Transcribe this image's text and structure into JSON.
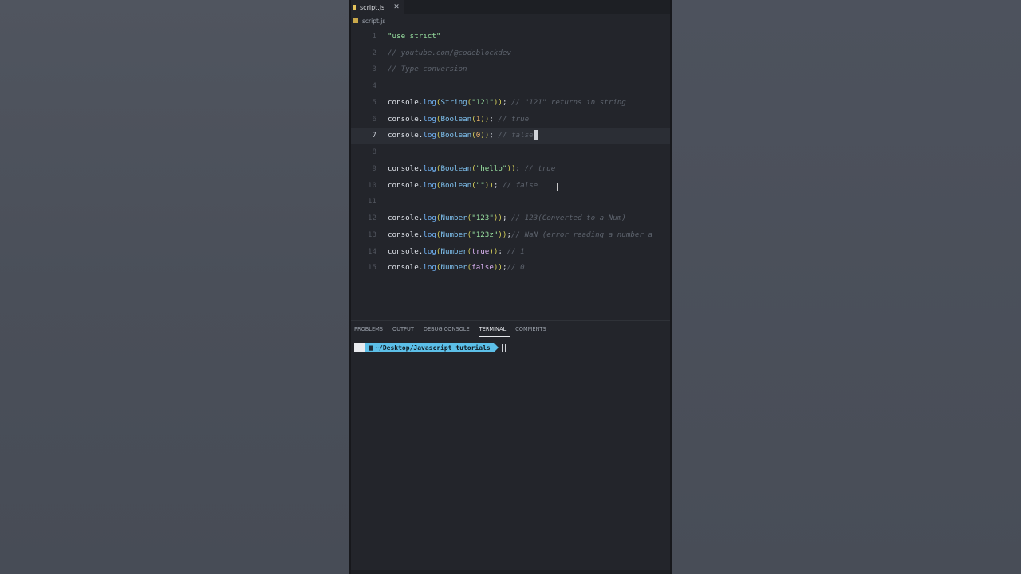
{
  "tab": {
    "filename": "script.js",
    "close": "✕"
  },
  "breadcrumb": {
    "filename": "script.js"
  },
  "code": [
    {
      "n": "1",
      "tokens": [
        [
          "str",
          "\"use strict\""
        ]
      ]
    },
    {
      "n": "2",
      "tokens": [
        [
          "cm",
          "// youtube.com/@codeblockdev"
        ]
      ]
    },
    {
      "n": "3",
      "tokens": [
        [
          "cm",
          "// Type conversion"
        ]
      ]
    },
    {
      "n": "4",
      "tokens": []
    },
    {
      "n": "5",
      "tokens": [
        [
          "src",
          "console"
        ],
        [
          "src",
          "."
        ],
        [
          "fn",
          "log"
        ],
        [
          "par",
          "("
        ],
        [
          "typ",
          "String"
        ],
        [
          "par",
          "("
        ],
        [
          "str",
          "\"121\""
        ],
        [
          "par",
          "))"
        ],
        [
          "src",
          "; "
        ],
        [
          "cm",
          "// \"121\" returns in string"
        ]
      ]
    },
    {
      "n": "6",
      "tokens": [
        [
          "src",
          "console"
        ],
        [
          "src",
          "."
        ],
        [
          "fn",
          "log"
        ],
        [
          "par",
          "("
        ],
        [
          "typ",
          "Boolean"
        ],
        [
          "par",
          "("
        ],
        [
          "num",
          "1"
        ],
        [
          "par",
          "))"
        ],
        [
          "src",
          "; "
        ],
        [
          "cm",
          "// true"
        ]
      ]
    },
    {
      "n": "7",
      "active": true,
      "tokens": [
        [
          "src",
          "console"
        ],
        [
          "src",
          "."
        ],
        [
          "fn",
          "log"
        ],
        [
          "par",
          "("
        ],
        [
          "typ",
          "Boolean"
        ],
        [
          "par",
          "("
        ],
        [
          "num",
          "0"
        ],
        [
          "par",
          "))"
        ],
        [
          "src",
          "; "
        ],
        [
          "cm",
          "// false"
        ],
        [
          "cursor",
          ""
        ]
      ]
    },
    {
      "n": "8",
      "tokens": []
    },
    {
      "n": "9",
      "tokens": [
        [
          "src",
          "console"
        ],
        [
          "src",
          "."
        ],
        [
          "fn",
          "log"
        ],
        [
          "par",
          "("
        ],
        [
          "typ",
          "Boolean"
        ],
        [
          "par",
          "("
        ],
        [
          "str",
          "\"hello\""
        ],
        [
          "par",
          "))"
        ],
        [
          "src",
          "; "
        ],
        [
          "cm",
          "// true"
        ]
      ]
    },
    {
      "n": "10",
      "tokens": [
        [
          "src",
          "console"
        ],
        [
          "src",
          "."
        ],
        [
          "fn",
          "log"
        ],
        [
          "par",
          "("
        ],
        [
          "typ",
          "Boolean"
        ],
        [
          "par",
          "("
        ],
        [
          "str",
          "\"\""
        ],
        [
          "par",
          "))"
        ],
        [
          "src",
          "; "
        ],
        [
          "cm",
          "// false"
        ]
      ]
    },
    {
      "n": "11",
      "tokens": []
    },
    {
      "n": "12",
      "tokens": [
        [
          "src",
          "console"
        ],
        [
          "src",
          "."
        ],
        [
          "fn",
          "log"
        ],
        [
          "par",
          "("
        ],
        [
          "typ",
          "Number"
        ],
        [
          "par",
          "("
        ],
        [
          "str",
          "\"123\""
        ],
        [
          "par",
          "))"
        ],
        [
          "src",
          "; "
        ],
        [
          "cm",
          "// 123(Converted to a Num)"
        ]
      ]
    },
    {
      "n": "13",
      "tokens": [
        [
          "src",
          "console"
        ],
        [
          "src",
          "."
        ],
        [
          "fn",
          "log"
        ],
        [
          "par",
          "("
        ],
        [
          "typ",
          "Number"
        ],
        [
          "par",
          "("
        ],
        [
          "str",
          "\"123z\""
        ],
        [
          "par",
          "))"
        ],
        [
          "src",
          ";"
        ],
        [
          "cm",
          "// NaN (error reading a number a"
        ]
      ]
    },
    {
      "n": "14",
      "tokens": [
        [
          "src",
          "console"
        ],
        [
          "src",
          "."
        ],
        [
          "fn",
          "log"
        ],
        [
          "par",
          "("
        ],
        [
          "typ",
          "Number"
        ],
        [
          "par",
          "("
        ],
        [
          "kw",
          "true"
        ],
        [
          "par",
          "))"
        ],
        [
          "src",
          "; "
        ],
        [
          "cm",
          "// 1"
        ]
      ]
    },
    {
      "n": "15",
      "tokens": [
        [
          "src",
          "console"
        ],
        [
          "src",
          "."
        ],
        [
          "fn",
          "log"
        ],
        [
          "par",
          "("
        ],
        [
          "typ",
          "Number"
        ],
        [
          "par",
          "("
        ],
        [
          "kw",
          "false"
        ],
        [
          "par",
          "))"
        ],
        [
          "src",
          ";"
        ],
        [
          "cm",
          "// 0"
        ]
      ]
    }
  ],
  "panel": {
    "tabs": [
      "PROBLEMS",
      "OUTPUT",
      "DEBUG CONSOLE",
      "TERMINAL",
      "COMMENTS"
    ],
    "active_tab": "TERMINAL"
  },
  "terminal": {
    "apple": "",
    "path": "~/Desktop/Javascript tutorials"
  },
  "colors": {
    "editor_bg": "#23252b",
    "terminal_path_bg": "#5cbfe8",
    "string": "#98e0a0",
    "function": "#71b3f5"
  }
}
